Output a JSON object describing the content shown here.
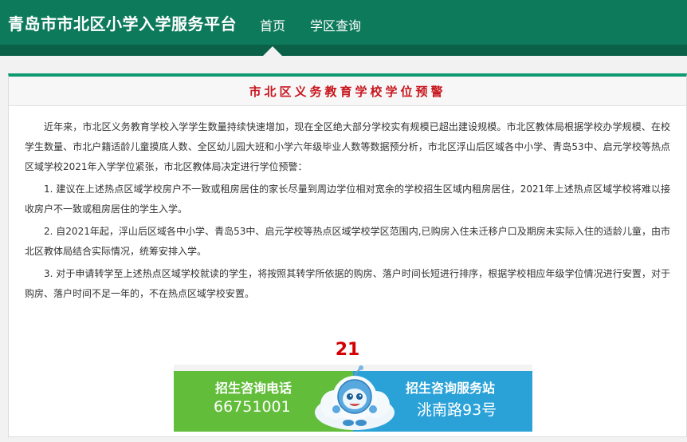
{
  "header": {
    "brand": "青岛市市北区小学入学服务平台",
    "nav": [
      {
        "label": "首页"
      },
      {
        "label": "学区查询"
      }
    ]
  },
  "notice": {
    "title": "市北区义务教育学校学位预警",
    "paragraphs": [
      "近年来，市北区义务教育学校入学学生数量持续快速增加，现在全区绝大部分学校实有规模已超出建设规模。市北区教体局根据学校办学规模、在校学生数量、市北户籍适龄儿童摸底人数、全区幼儿园大班和小学六年级毕业人数等数据预分析，市北区浮山后区域各中小学、青岛53中、启元学校等热点区域学校2021年入学学位紧张，市北区教体局决定进行学位预警：",
      "1. 建议在上述热点区域学校房户不一致或租房居住的家长尽量到周边学位相对宽余的学校招生区域内租房居住，2021年上述热点区域学校将难以接收房户不一致或租房居住的学生入学。",
      "2. 自2021年起，浮山后区域各中小学、青岛53中、启元学校等热点区域学校学区范围内,已购房入住未迁移户口及期房未实际入住的适龄儿童，由市北区教体局结合实际情况，统筹安排入学。",
      "3. 对于申请转学至上述热点区域学校就读的学生，将按照其转学所依据的购房、落户时间长短进行排序，根据学校相应年级学位情况进行安置，对于购房、落户时间不足一年的，不在热点区域学校安置。"
    ],
    "countdown": "21"
  },
  "banner": {
    "phone_label": "招生咨询电话",
    "phone_value": "66751001",
    "station_label": "招生咨询服务站",
    "station_value": "洮南路93号",
    "mascot_icon": "cloud-mascot-icon",
    "colors": {
      "left": "#62bd3a",
      "right": "#2aa2d8"
    }
  },
  "colors": {
    "header": "#0e7a5c",
    "accent": "#0e9a70",
    "title_red": "#c8161e"
  }
}
